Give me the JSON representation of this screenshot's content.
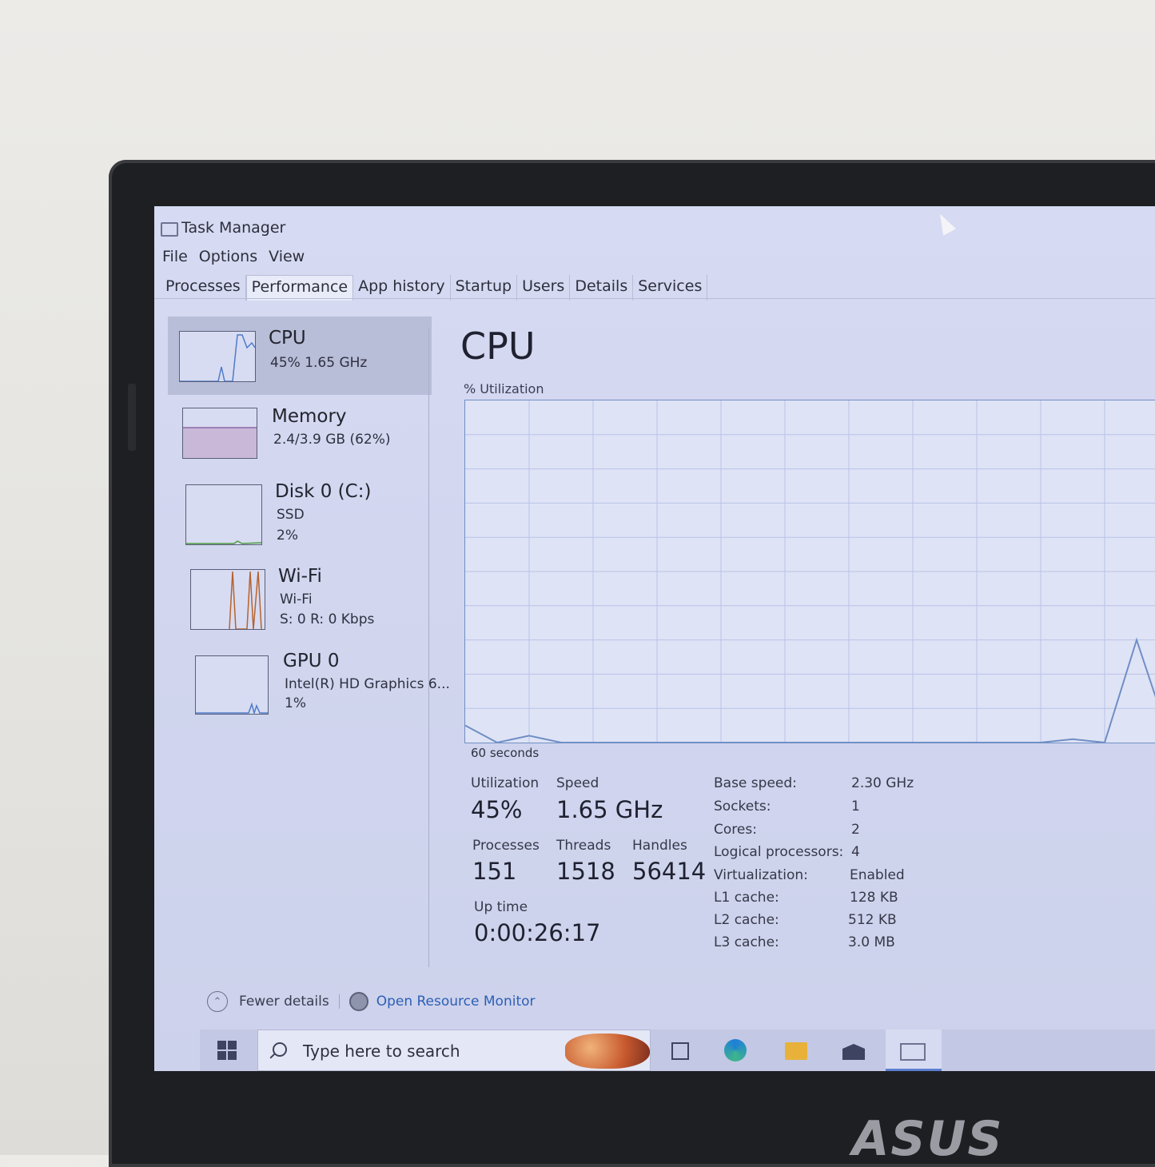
{
  "window": {
    "title": "Task Manager"
  },
  "menu": [
    "File",
    "Options",
    "View"
  ],
  "tabs": [
    "Processes",
    "Performance",
    "App history",
    "Startup",
    "Users",
    "Details",
    "Services"
  ],
  "sidebar": {
    "items": [
      {
        "name": "CPU",
        "sub1": "45%  1.65 GHz",
        "sub2": ""
      },
      {
        "name": "Memory",
        "sub1": "2.4/3.9 GB (62%)",
        "sub2": ""
      },
      {
        "name": "Disk 0 (C:)",
        "sub1": "SSD",
        "sub2": "2%"
      },
      {
        "name": "Wi-Fi",
        "sub1": "Wi-Fi",
        "sub2": "S: 0  R: 0 Kbps"
      },
      {
        "name": "GPU 0",
        "sub1": "Intel(R) HD Graphics 6...",
        "sub2": "1%"
      }
    ]
  },
  "main": {
    "title": "CPU",
    "util_label": "% Utilization",
    "axis_label": "60 seconds",
    "stats": {
      "utilization_label": "Utilization",
      "utilization": "45%",
      "speed_label": "Speed",
      "speed": "1.65 GHz",
      "processes_label": "Processes",
      "processes": "151",
      "threads_label": "Threads",
      "threads": "1518",
      "handles_label": "Handles",
      "handles": "56414",
      "uptime_label": "Up time",
      "uptime": "0:00:26:17"
    },
    "info": [
      {
        "k": "Base speed:",
        "v": "2.30 GHz"
      },
      {
        "k": "Sockets:",
        "v": "1"
      },
      {
        "k": "Cores:",
        "v": "2"
      },
      {
        "k": "Logical processors:",
        "v": "4"
      },
      {
        "k": "Virtualization:",
        "v": "Enabled"
      },
      {
        "k": "L1 cache:",
        "v": "128 KB"
      },
      {
        "k": "L2 cache:",
        "v": "512 KB"
      },
      {
        "k": "L3 cache:",
        "v": "3.0 MB"
      }
    ]
  },
  "footer": {
    "fewer": "Fewer details",
    "monitor": "Open Resource Monitor"
  },
  "taskbar": {
    "search_placeholder": "Type here to search"
  },
  "logo": "ASUS",
  "cpu_graph": {
    "y_range": [
      0,
      100
    ],
    "values": [
      5,
      0,
      2,
      0,
      0,
      0,
      0,
      0,
      0,
      0,
      0,
      0,
      0,
      0,
      0,
      0,
      0,
      0,
      0,
      1,
      0,
      30,
      2
    ]
  },
  "colors": {
    "accent": "#2c5fb5",
    "graph_line": "#6f8fc4"
  }
}
